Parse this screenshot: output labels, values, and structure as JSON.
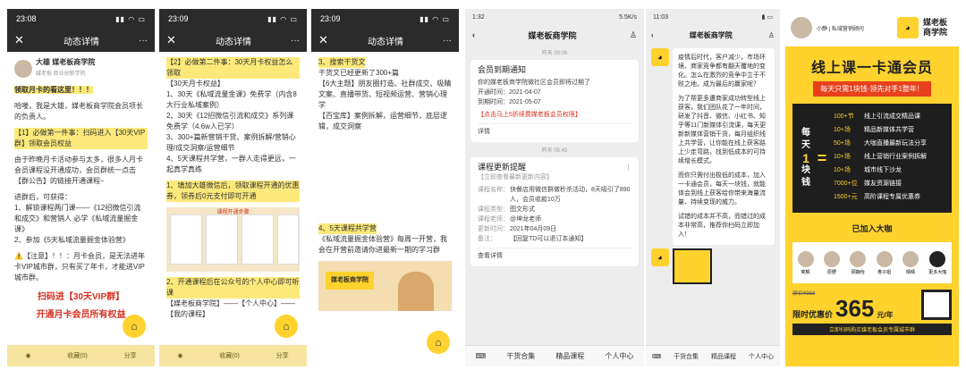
{
  "p1": {
    "status_time": "23:08",
    "title": "动态详情",
    "author": "大雄 媒老板商学院",
    "author_sub": "媒老板 商业创新学院",
    "lines": [
      "领取月卡的看这里！！！",
      "哈喽，我是大雄，媒老板商学院会员项长的负责人。",
      "【1】必做第一件事：扫码进入【30天VIP群】领取会员权益",
      "由于昨晚月卡活动参与太多，很多人月卡会员课程没开通成功，会员群统一点击【群公告】的链接开通课程~",
      "进群后，可获得：",
      "1、解锁课程两门课——《12招微信引流和成交》和营销人 必学《私域流量掘金课》",
      "2、参加《5天私域流量掘金体验营》",
      "⚠️【注意】！！：月卡会员，是无法进年卡VIP城市群，只有买了年卡，才能进VIP城市群。",
      "扫码进【30天VIP群】",
      "开通月卡会员所有权益"
    ],
    "bottom": [
      "",
      "收藏(0)",
      "分享"
    ]
  },
  "p2": {
    "status_time": "23:09",
    "title": "动态详情",
    "lines": [
      "【2】必做第二件事：30天月卡权益怎么领取",
      "【30天月卡权益】",
      "1、30天《私域流量金课》免费学（内含8大行业私域案例）",
      "2、30天《12招微信引流和成交》系列课免费学（4.6w人已学）",
      "3、300+篇新营销干货、案例拆解/营销心理/成交洞察/运营细节",
      "4、5天课程共学营，一群人走得更远，一起真学真练",
      "1、填加大雄微信后，领取课程开通的优惠券，领券后0元支付即可开通",
      "课程开通步骤",
      "2、开通课程后在公众号的个人中心即可听课",
      "【媒老板商学院】——【个人中心】——【我的课程】"
    ],
    "bottom": [
      "",
      "收藏(0)",
      "分享"
    ]
  },
  "p3": {
    "status_time": "23:09",
    "title": "动态详情",
    "lines": [
      "3、搜索干货文",
      "干货文已经更新了300+篇",
      "【6大主题】朋友圈打造、社群成交、吸睛文案、直播带货、短视频运营、营销心理学",
      "【百宝库】案例拆解，运营细节，底层逻辑，成交洞察",
      "4、5天课程共学营",
      "《私域流量掘金体验营》每周一开营，我会在开营前邀请你进最新一期的学习群",
      "媒老板商学院"
    ]
  },
  "p4": {
    "status_time": "1:32",
    "status_right": "5.5K/s",
    "title": "媒老板商学院",
    "time1": "昨天 00:06",
    "card1_title": "会员到期通知",
    "card1_body": "你的媒老板商学院微社区会员即将过期了",
    "card1_rows": [
      "开通时间：2021-04-07",
      "到期时间：2021-05-07"
    ],
    "card1_link": "【点击马上5折续费媒老板会员权限】",
    "card1_foot": "详情",
    "time2": "昨天 05:45",
    "card2_title": "课程更新提醒",
    "card2_sub": "【立即查看最新更新内容】",
    "card2_rows": [
      [
        "课程名称：",
        "快餐店用微信群做秒杀活动，8天吸引了890人，会员收款10万"
      ],
      [
        "课程类型：",
        "图文形式"
      ],
      [
        "课程老师：",
        "@坤龙老师"
      ],
      [
        "更新时间：",
        "2021年04月09日"
      ],
      [
        "备注：",
        "【回复TD可以退订本通知】"
      ]
    ],
    "card2_foot": "查看详情",
    "nav": [
      "干货合集",
      "精品课程",
      "个人中心"
    ]
  },
  "p5": {
    "status_time": "11:03",
    "title": "媒老板商学院",
    "para1": "疫情后时代，客户减少，市场环境、商家竞争都有翻天覆地的变化。怎么在激烈的竞争中立于不败之地，成为最后的赢家呢？",
    "para2": "为了帮更多遭商家成功转型线上获客，我们团队花了一年时间，研发了抖音、微信、小红书、知乎等11门新媒体引流课，每天更新新媒体营销干货，每月组织线上共学营，让你能在线上获客路上少走弯路，找到低成本的可持续增长模式。",
    "para3": "而你只需付出极低的成本，加入一卡通会员，每天一块钱，就能体会到线上获客给你带来海量流量、持续变现的威力。",
    "para4": "试错的成本并不高，而错过的成本非常高，推荐你扫码立即加入！",
    "nav": [
      "干货合集",
      "精品课程",
      "个人中心"
    ]
  },
  "p6": {
    "header_name": "小静 | 私域营销顾问",
    "brand": "媒老板商学院",
    "headline": "线上课一卡通会员",
    "tagline": "每天只需1块钱·领先对手1整年！",
    "big": [
      "每",
      "天",
      "1",
      "块",
      "钱"
    ],
    "eq": "=",
    "stats": [
      [
        "100+节",
        "线上引流成交精品课"
      ],
      [
        "10+场",
        "精品新媒体共学营"
      ],
      [
        "50+场",
        "大咖直播最新玩法分享"
      ],
      [
        "10+场",
        "线上营销行业案例拆解"
      ],
      [
        "10+场",
        "城市线下沙龙"
      ],
      [
        "7000+位",
        "媒友资源链接"
      ],
      [
        "1500+元",
        "高阶课程专属优惠券"
      ]
    ],
    "joined": "已加入大咖",
    "names": [
      "奕枫",
      "原野",
      "顾静怡",
      "卷子姐",
      "晴晴",
      "更多大咖"
    ],
    "orig": "原价¥368",
    "price_label": "限时优惠价",
    "price": "365",
    "unit": "元/年",
    "scan": "立即扫码购买媒老板会员专属城市群"
  }
}
